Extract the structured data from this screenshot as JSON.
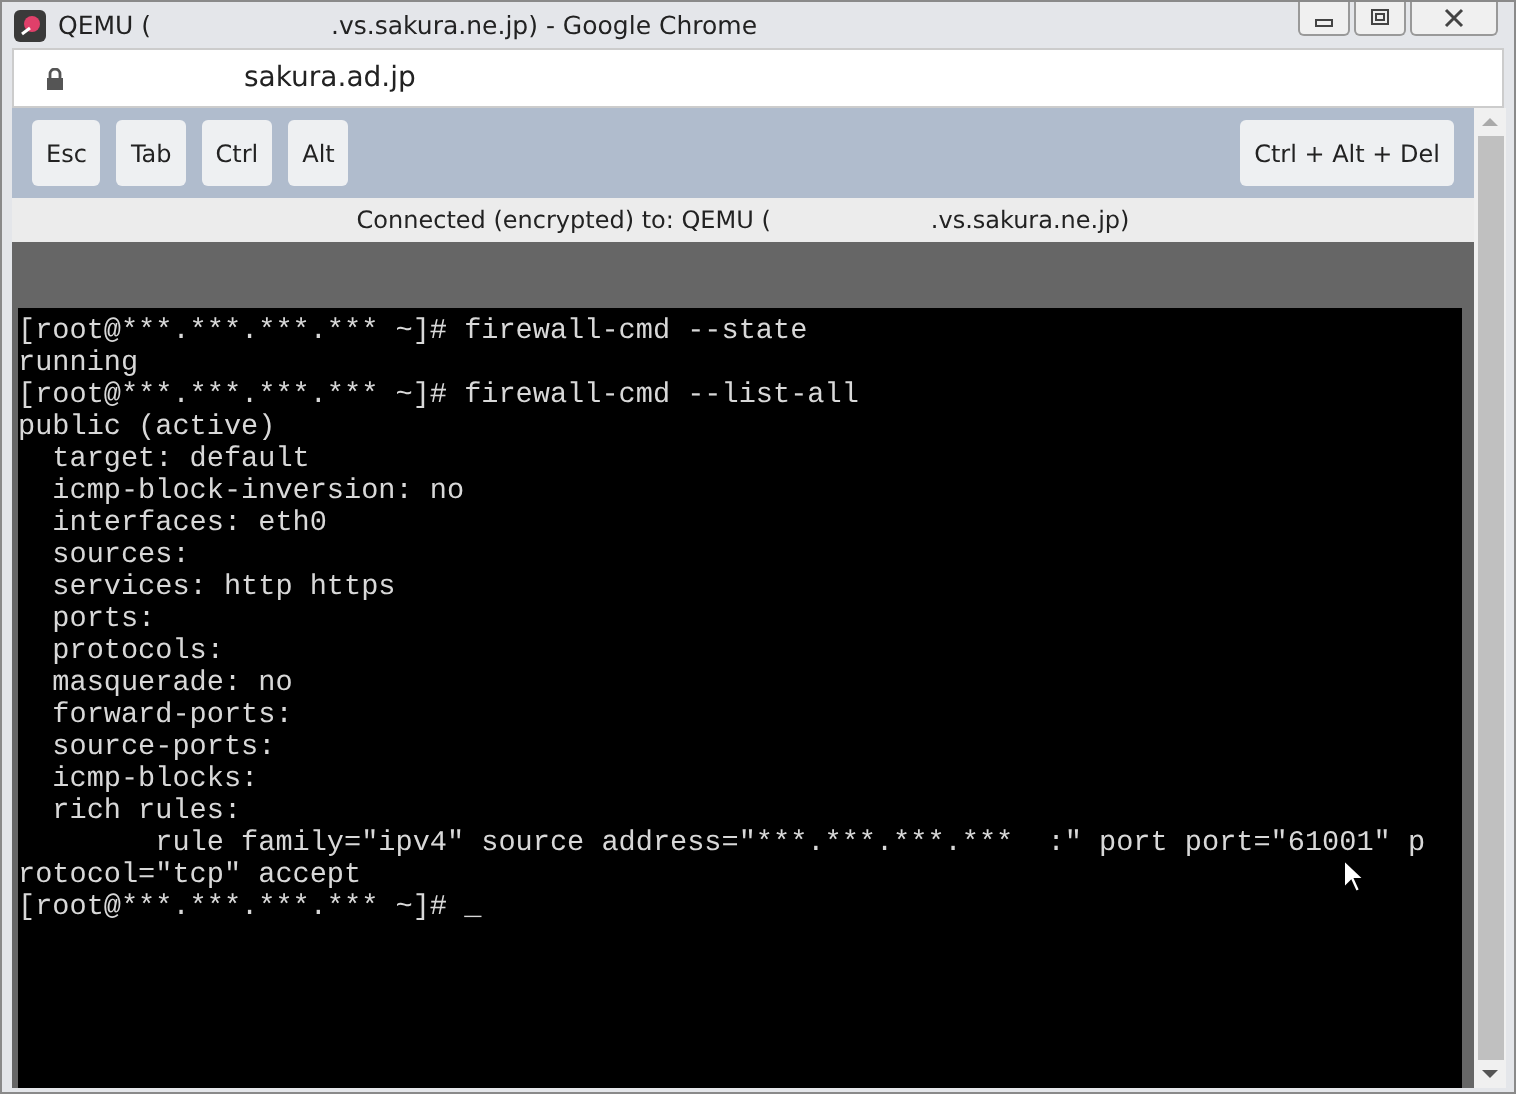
{
  "window": {
    "title_parts": [
      "QEMU (",
      ".vs.sakura.ne.jp) - Google Chrome"
    ]
  },
  "address_bar": {
    "url": "sakura.ad.jp"
  },
  "toolbar": {
    "keys": [
      "Esc",
      "Tab",
      "Ctrl",
      "Alt"
    ],
    "combo_key": "Ctrl + Alt + Del"
  },
  "status": {
    "parts": [
      "Connected (encrypted) to: QEMU (",
      ".vs.sakura.ne.jp)"
    ]
  },
  "terminal": {
    "lines": [
      "[root@***.***.***.*** ~]# firewall-cmd --state",
      "running",
      "[root@***.***.***.*** ~]# firewall-cmd --list-all",
      "public (active)",
      "  target: default",
      "  icmp-block-inversion: no",
      "  interfaces: eth0",
      "  sources:",
      "  services: http https",
      "  ports:",
      "  protocols:",
      "  masquerade: no",
      "  forward-ports:",
      "  source-ports:",
      "  icmp-blocks:",
      "  rich rules:",
      "        rule family=\"ipv4\" source address=\"***.***.***.***  :\" port port=\"61001\" p",
      "rotocol=\"tcp\" accept",
      "[root@***.***.***.*** ~]# _"
    ]
  }
}
